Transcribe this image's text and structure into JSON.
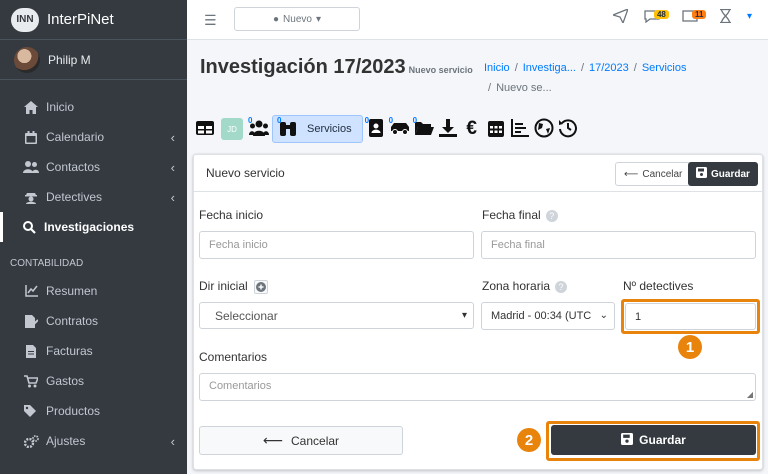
{
  "brand": {
    "logo_text": "INN",
    "name": "InterPiNet"
  },
  "user": {
    "name": "Philip M"
  },
  "sidebar": {
    "items": [
      {
        "label": "Inicio",
        "icon": "home-icon"
      },
      {
        "label": "Calendario",
        "icon": "calendar-icon",
        "has_children": true
      },
      {
        "label": "Contactos",
        "icon": "users-icon",
        "has_children": true
      },
      {
        "label": "Detectives",
        "icon": "detective-icon",
        "has_children": true
      },
      {
        "label": "Investigaciones",
        "icon": "search-icon",
        "active": true
      }
    ],
    "section_header": "CONTABILIDAD",
    "accounting_items": [
      {
        "label": "Resumen",
        "icon": "chart-line-icon"
      },
      {
        "label": "Contratos",
        "icon": "file-signature-icon"
      },
      {
        "label": "Facturas",
        "icon": "invoice-icon"
      },
      {
        "label": "Gastos",
        "icon": "cart-icon"
      },
      {
        "label": "Productos",
        "icon": "tags-icon"
      },
      {
        "label": "Ajustes",
        "icon": "cogs-icon",
        "has_children": true
      }
    ]
  },
  "topbar": {
    "nuevo_label": "Nuevo",
    "badge_messages": "48",
    "badge_alerts": "11"
  },
  "header": {
    "title": "Investigación 17/2023",
    "subtitle": "Nuevo servicio",
    "breadcrumb": [
      "Inicio",
      "Investiga...",
      "17/2023",
      "Servicios",
      "Nuevo se..."
    ]
  },
  "toolbar": {
    "initials": "JD",
    "servicios_label": "Servicios",
    "zero_badge": "0",
    "euro": "€"
  },
  "form": {
    "card_title": "Nuevo servicio",
    "cancel_label": "Cancelar",
    "save_label": "Guardar",
    "fecha_inicio_label": "Fecha inicio",
    "fecha_inicio_placeholder": "Fecha inicio",
    "fecha_final_label": "Fecha final",
    "fecha_final_placeholder": "Fecha final",
    "dir_inicial_label": "Dir inicial",
    "dir_inicial_value": "Seleccionar",
    "zona_horaria_label": "Zona horaria",
    "zona_horaria_value": "Madrid - 00:34 (UTC",
    "detectives_label": "Nº detectives",
    "detectives_value": "1",
    "comentarios_label": "Comentarios",
    "comentarios_placeholder": "Comentarios",
    "help_glyph": "?"
  },
  "annotations": {
    "step1": "1",
    "step2": "2",
    "color": "#e8830c"
  }
}
